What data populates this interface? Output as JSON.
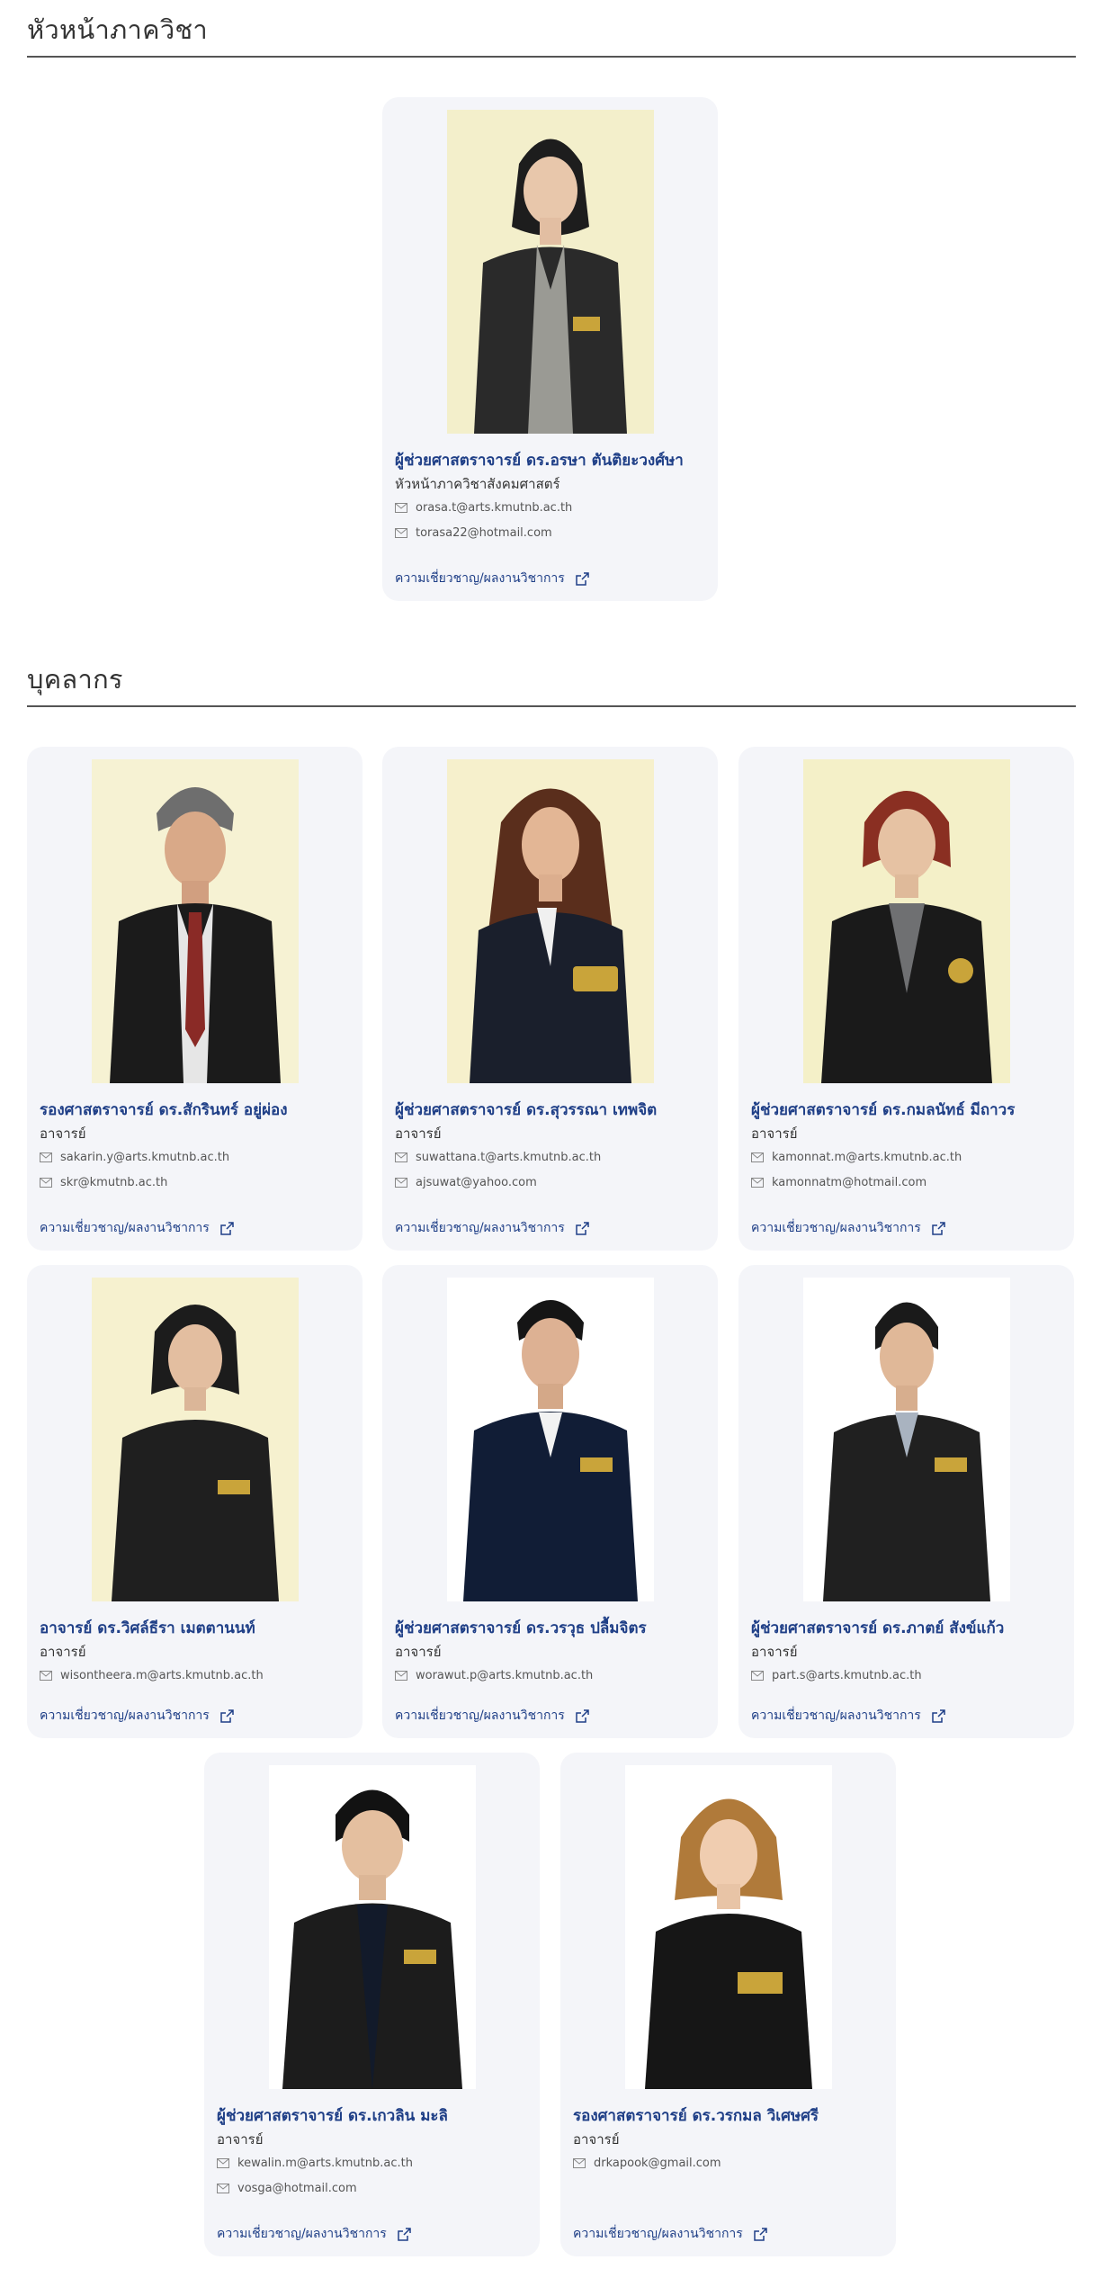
{
  "sections": {
    "head_title": "หัวหน้าภาควิชา",
    "staff_title": "บุคลากร"
  },
  "link_label": "ความเชี่ยวชาญ/ผลงานวิชาการ",
  "head": {
    "name": "ผู้ช่วยศาสตราจารย์ ดร.อรษา ตันติยะวงศ์ษา",
    "position": "หัวหน้าภาควิชาสังคมศาสตร์",
    "emails": [
      "orasa.t@arts.kmutnb.ac.th",
      "torasa22@hotmail.com"
    ]
  },
  "staff": [
    {
      "name": "รองศาสตราจารย์ ดร.สักรินทร์ อยู่ผ่อง",
      "position": "อาจารย์",
      "emails": [
        "sakarin.y@arts.kmutnb.ac.th",
        "skr@kmutnb.ac.th"
      ]
    },
    {
      "name": "ผู้ช่วยศาสตราจารย์ ดร.สุวรรณา เทพจิต",
      "position": "อาจารย์",
      "emails": [
        "suwattana.t@arts.kmutnb.ac.th",
        "ajsuwat@yahoo.com"
      ]
    },
    {
      "name": "ผู้ช่วยศาสตราจารย์ ดร.กมลนัทธ์ มีถาวร",
      "position": "อาจารย์",
      "emails": [
        "kamonnat.m@arts.kmutnb.ac.th",
        "kamonnatm@hotmail.com"
      ]
    },
    {
      "name": "อาจารย์ ดร.วิศล์ธีรา เมตตานนท์",
      "position": "อาจารย์",
      "emails": [
        "wisontheera.m@arts.kmutnb.ac.th"
      ]
    },
    {
      "name": "ผู้ช่วยศาสตราจารย์ ดร.วรวุธ ปลื้มจิตร",
      "position": "อาจารย์",
      "emails": [
        "worawut.p@arts.kmutnb.ac.th"
      ]
    },
    {
      "name": "ผู้ช่วยศาสตราจารย์ ดร.ภาตย์ สังข์แก้ว",
      "position": "อาจารย์",
      "emails": [
        "part.s@arts.kmutnb.ac.th"
      ]
    },
    {
      "name": "ผู้ช่วยศาสตราจารย์ ดร.เกวลิน มะลิ",
      "position": "อาจารย์",
      "emails": [
        "kewalin.m@arts.kmutnb.ac.th",
        "vosga@hotmail.com"
      ]
    },
    {
      "name": "รองศาสตราจารย์ ดร.วรกมล วิเศษศรี",
      "position": "อาจารย์",
      "emails": [
        "drkapook@gmail.com"
      ]
    }
  ],
  "colors": {
    "name": "#1f3f87",
    "card_bg": "#f4f5f9",
    "photo_bg_cream": "#f3efcb",
    "photo_bg_white": "#ffffff"
  }
}
